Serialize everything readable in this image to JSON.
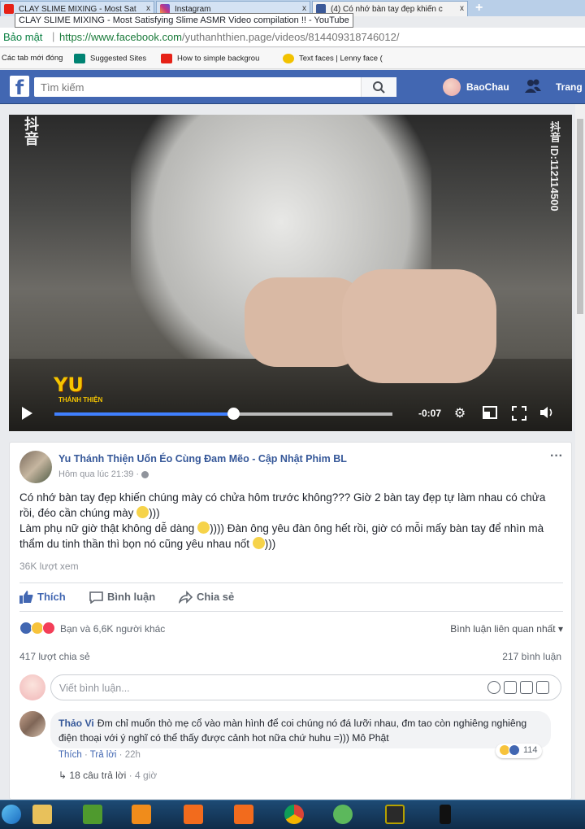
{
  "browser": {
    "tabs": [
      {
        "title": "CLAY SLIME MIXING - Most Sat",
        "favicon": "youtube-icon",
        "color": "#e62117"
      },
      {
        "title": "Instagram",
        "favicon": "instagram-icon",
        "color": "#c13584"
      },
      {
        "title": "(4) Có nhớ bàn tay đẹp khiến c",
        "favicon": "facebook-icon",
        "color": "#3b5998"
      }
    ],
    "tab_close": "x",
    "new_tab": "+",
    "tooltip": "CLAY SLIME MIXING - Most Satisfying Slime ASMR Video compilation !! - YouTube",
    "security_label": "Bảo mật",
    "url_prefix": "https://www.facebook.com",
    "url_path": "/yuthanhthien.page/videos/814409318746012/",
    "bookmarks": [
      {
        "label": "Các tab mới đóng",
        "icon": "none"
      },
      {
        "label": "Suggested Sites",
        "icon": "bing-icon"
      },
      {
        "label": "How to simple backgrou",
        "icon": "youtube-icon"
      },
      {
        "label": "Text faces | Lenny face (",
        "icon": "lenny-face-icon"
      }
    ]
  },
  "facebook": {
    "logo": "f",
    "search_placeholder": "Tìm kiếm",
    "user_name": "BaoChau",
    "home_label": "Trang"
  },
  "video": {
    "watermark_left": "抖音",
    "watermark_right": "抖音 ID:112114500",
    "logo_text": "YU",
    "logo_sub": "THÁNH THIỆN",
    "time_remaining": "-0:07",
    "progress": 0.53
  },
  "post": {
    "page_name": "Yu Thánh Thiện Uốn Éo Cùng Đam Mẽo - Cập Nhật Phim BL",
    "time": "Hôm qua lúc 21:39 ·",
    "more": "···",
    "line1": "Có nhớ bàn tay đẹp khiến chúng mày có chửa hôm trước không??? Giờ 2 bàn tay đẹp tự làm nhau có chửa rồi, đéo cần chúng mày",
    "line1_end": ")))",
    "line2a": "Làm phụ nữ giờ thật không dễ dàng",
    "line2b": ")))) Đàn ông yêu đàn ông hết rồi, giờ có mỗi mấy bàn tay để nhìn mà thẩm du tinh thần thì bọn nó cũng yêu nhau nốt",
    "line2_end": ")))",
    "views": "36K lượt xem",
    "like_label": "Thích",
    "comment_label": "Bình luận",
    "share_label": "Chia sẻ",
    "reactions_text": "Bạn và 6,6K người khác",
    "sort_label": "Bình luận liên quan nhất ▾",
    "shares_count": "417 lượt chia sẻ",
    "comments_count": "217 bình luận",
    "comment_placeholder": "Viết bình luận..."
  },
  "comment": {
    "author": "Thảo Vi",
    "text": "Đm chỉ muốn thò mẹ cổ vào màn hình để coi chúng nó đá lưỡi nhau, đm tao còn nghiêng nghiêng điện thoại với ý nghĩ có thể thấy được cảnh hot nữa chứ huhu =))) Mô Phật",
    "like": "Thích",
    "sep": " · ",
    "reply": "Trả lời",
    "time": "22h",
    "reaction_count": "114",
    "replies_text": "18 câu trả lời",
    "replies_time": "· 4 giờ"
  },
  "taskbar": {
    "items": [
      "windows-start-icon",
      "file-explorer-icon",
      "game-icon",
      "video-player-icon",
      "camera-app-icon",
      "camera-app-icon-2",
      "chrome-icon",
      "coccoc-icon",
      "media-icon",
      "phone-icon"
    ]
  },
  "colors": {
    "fb_blue": "#4267b2",
    "link": "#365899"
  }
}
